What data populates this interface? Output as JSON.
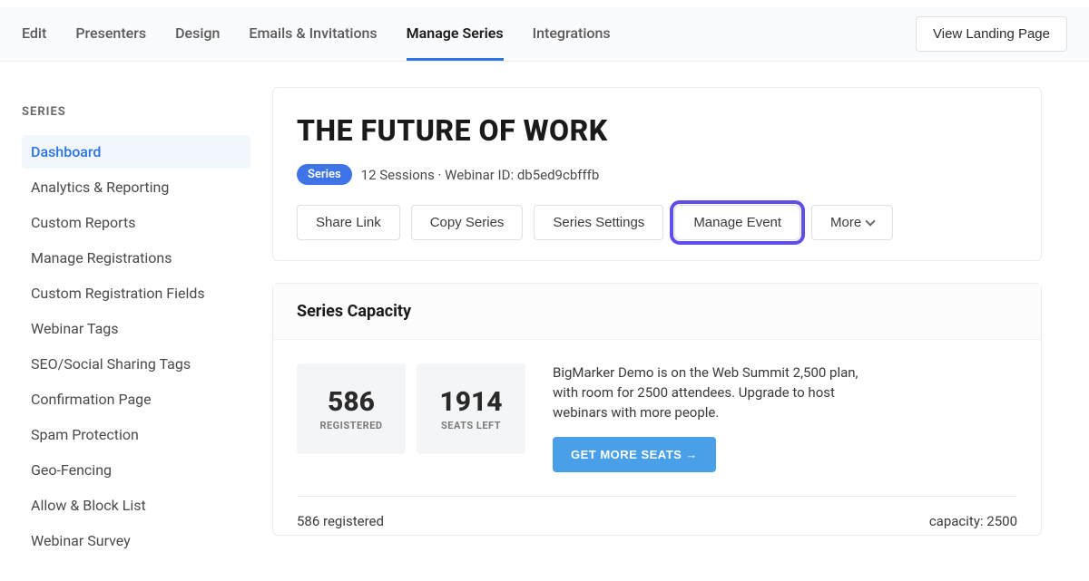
{
  "nav": {
    "tabs": [
      {
        "label": "Edit"
      },
      {
        "label": "Presenters"
      },
      {
        "label": "Design"
      },
      {
        "label": "Emails & Invitations"
      },
      {
        "label": "Manage Series"
      },
      {
        "label": "Integrations"
      }
    ],
    "view_landing": "View Landing Page"
  },
  "sidebar": {
    "heading": "SERIES",
    "items": [
      {
        "label": "Dashboard"
      },
      {
        "label": "Analytics & Reporting"
      },
      {
        "label": "Custom Reports"
      },
      {
        "label": "Manage Registrations"
      },
      {
        "label": "Custom Registration Fields"
      },
      {
        "label": "Webinar Tags"
      },
      {
        "label": "SEO/Social Sharing Tags"
      },
      {
        "label": "Confirmation Page"
      },
      {
        "label": "Spam Protection"
      },
      {
        "label": "Geo-Fencing"
      },
      {
        "label": "Allow & Block List"
      },
      {
        "label": "Webinar Survey"
      }
    ]
  },
  "header": {
    "title": "THE FUTURE OF WORK",
    "badge": "Series",
    "meta": "12 Sessions · Webinar ID: db5ed9cbfffb"
  },
  "actions": {
    "share": "Share Link",
    "copy": "Copy Series",
    "settings": "Series Settings",
    "manage": "Manage Event",
    "more": "More"
  },
  "capacity": {
    "title": "Series Capacity",
    "registered_num": "586",
    "registered_label": "REGISTERED",
    "seats_num": "1914",
    "seats_label": "SEATS LEFT",
    "description": "BigMarker Demo is on the Web Summit 2,500 plan, with room for 2500 attendees. Upgrade to host webinars with more people.",
    "cta": "GET MORE SEATS →",
    "footer_left": "586 registered",
    "footer_right": "capacity: 2500"
  }
}
